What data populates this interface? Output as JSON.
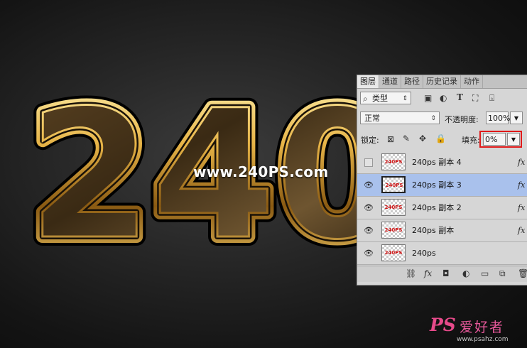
{
  "artwork": {
    "text": "240",
    "watermark": "www.240PS.com"
  },
  "branding": {
    "logo": "PS",
    "name": "爱好者",
    "url": "www.psahz.com"
  },
  "panel": {
    "tabs": [
      "图层",
      "通道",
      "路径",
      "历史记录",
      "动作"
    ],
    "filter_kind": "类型",
    "blend_mode": "正常",
    "opacity_label": "不透明度:",
    "opacity_value": "100%",
    "lock_label": "锁定:",
    "fill_label": "填充:",
    "fill_value": "0%",
    "thumbnail_text": "240PS",
    "fx_label": "fx",
    "layers": [
      {
        "name": "240ps 副本 4",
        "visible": false,
        "selected": false
      },
      {
        "name": "240ps 副本 3",
        "visible": true,
        "selected": true
      },
      {
        "name": "240ps 副本 2",
        "visible": true,
        "selected": false
      },
      {
        "name": "240ps 副本",
        "visible": true,
        "selected": false
      },
      {
        "name": "240ps",
        "visible": true,
        "selected": false
      }
    ]
  },
  "colors": {
    "selected_row": "#a9c1ec",
    "highlight_box": "#e01a1a",
    "gold": "#d9a93a"
  }
}
